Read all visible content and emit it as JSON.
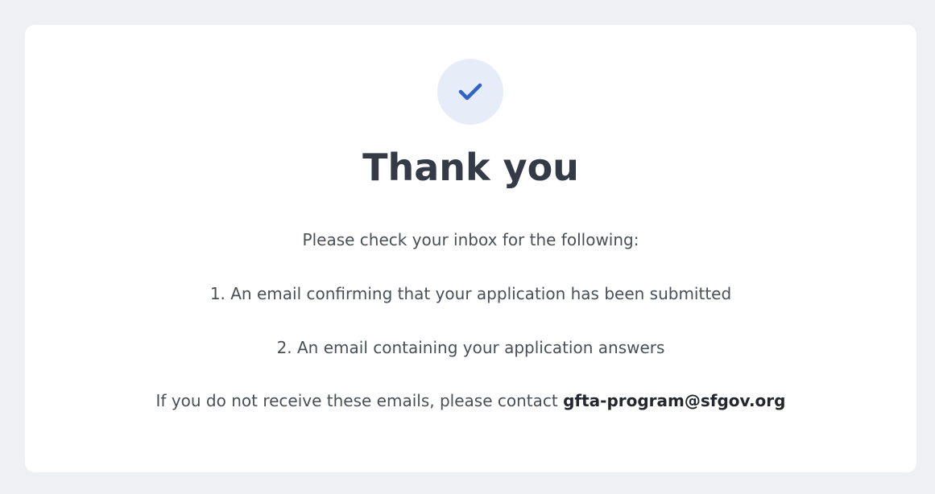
{
  "confirmation": {
    "icon": "check-icon",
    "accent_color": "#2f63c8",
    "title": "Thank you",
    "intro": "Please check your inbox for the following:",
    "items": [
      "1. An email confirming that your application has been submitted",
      "2. An email containing your application answers"
    ],
    "contact_text": "If you do not receive these emails, please contact",
    "contact_email": "gfta-program@sfgov.org"
  }
}
